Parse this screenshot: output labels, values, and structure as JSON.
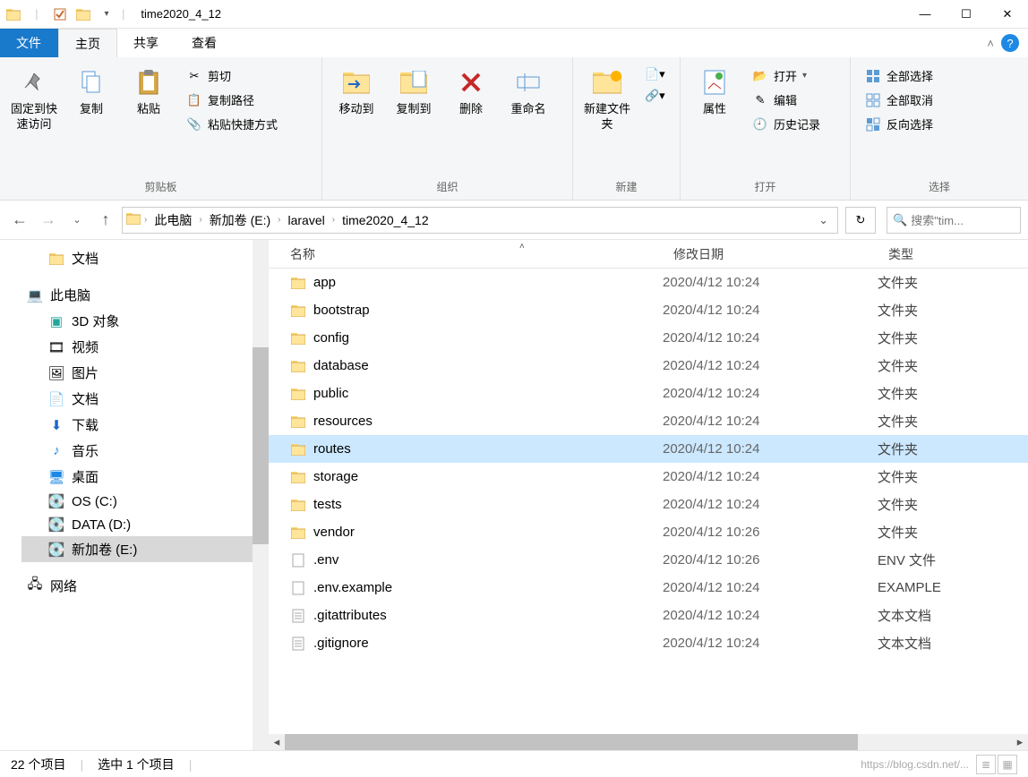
{
  "window": {
    "title": "time2020_4_12"
  },
  "tabs": {
    "file": "文件",
    "home": "主页",
    "share": "共享",
    "view": "查看"
  },
  "ribbon": {
    "pin": "固定到快速访问",
    "copy": "复制",
    "paste": "粘贴",
    "cut": "剪切",
    "copypath": "复制路径",
    "pasteshortcut": "粘贴快捷方式",
    "group_clipboard": "剪贴板",
    "moveto": "移动到",
    "copyto": "复制到",
    "delete": "删除",
    "rename": "重命名",
    "group_organize": "组织",
    "newfolder": "新建文件夹",
    "group_new": "新建",
    "properties": "属性",
    "open": "打开",
    "edit": "编辑",
    "history": "历史记录",
    "group_open": "打开",
    "selectall": "全部选择",
    "selectnone": "全部取消",
    "invert": "反向选择",
    "group_select": "选择"
  },
  "breadcrumb": {
    "pc": "此电脑",
    "drive": "新加卷 (E:)",
    "p1": "laravel",
    "p2": "time2020_4_12"
  },
  "search": {
    "placeholder": "搜索\"tim..."
  },
  "cols": {
    "name": "名称",
    "date": "修改日期",
    "type": "类型"
  },
  "tree": {
    "docs": "文档",
    "pc": "此电脑",
    "3d": "3D 对象",
    "video": "视频",
    "pictures": "图片",
    "docs2": "文档",
    "downloads": "下载",
    "music": "音乐",
    "desktop": "桌面",
    "osc": "OS (C:)",
    "datad": "DATA (D:)",
    "newe": "新加卷 (E:)",
    "network": "网络"
  },
  "files": [
    {
      "name": "app",
      "date": "2020/4/12 10:24",
      "type": "文件夹",
      "kind": "folder"
    },
    {
      "name": "bootstrap",
      "date": "2020/4/12 10:24",
      "type": "文件夹",
      "kind": "folder"
    },
    {
      "name": "config",
      "date": "2020/4/12 10:24",
      "type": "文件夹",
      "kind": "folder"
    },
    {
      "name": "database",
      "date": "2020/4/12 10:24",
      "type": "文件夹",
      "kind": "folder"
    },
    {
      "name": "public",
      "date": "2020/4/12 10:24",
      "type": "文件夹",
      "kind": "folder"
    },
    {
      "name": "resources",
      "date": "2020/4/12 10:24",
      "type": "文件夹",
      "kind": "folder"
    },
    {
      "name": "routes",
      "date": "2020/4/12 10:24",
      "type": "文件夹",
      "kind": "folder",
      "selected": true
    },
    {
      "name": "storage",
      "date": "2020/4/12 10:24",
      "type": "文件夹",
      "kind": "folder"
    },
    {
      "name": "tests",
      "date": "2020/4/12 10:24",
      "type": "文件夹",
      "kind": "folder"
    },
    {
      "name": "vendor",
      "date": "2020/4/12 10:26",
      "type": "文件夹",
      "kind": "folder"
    },
    {
      "name": ".env",
      "date": "2020/4/12 10:26",
      "type": "ENV 文件",
      "kind": "file"
    },
    {
      "name": ".env.example",
      "date": "2020/4/12 10:24",
      "type": "EXAMPLE",
      "kind": "file"
    },
    {
      "name": ".gitattributes",
      "date": "2020/4/12 10:24",
      "type": "文本文档",
      "kind": "text"
    },
    {
      "name": ".gitignore",
      "date": "2020/4/12 10:24",
      "type": "文本文档",
      "kind": "text"
    }
  ],
  "status": {
    "count": "22 个项目",
    "selection": "选中 1 个项目",
    "watermark": "https://blog.csdn.net/..."
  }
}
